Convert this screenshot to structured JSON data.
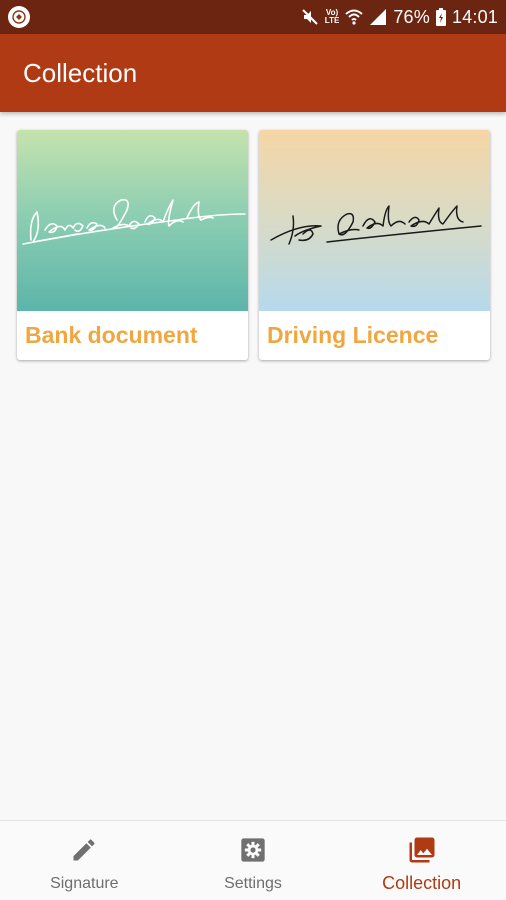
{
  "status_bar": {
    "battery_percent": "76%",
    "time": "14:01",
    "network_label_top": "Vo)",
    "network_label_bottom": "LTE",
    "icons": [
      "app-notification-icon",
      "mute-icon",
      "volte-icon",
      "wifi-icon",
      "signal-icon",
      "battery-icon"
    ]
  },
  "app_bar": {
    "title": "Collection",
    "color": "#b03a14"
  },
  "collection": {
    "items": [
      {
        "label": "Bank document",
        "signature_text": "LaraCroft"
      },
      {
        "label": "Driving Licence",
        "signature_text": "K. Atatürk"
      }
    ]
  },
  "bottom_nav": {
    "items": [
      {
        "label": "Signature",
        "icon": "pencil-icon",
        "active": false
      },
      {
        "label": "Settings",
        "icon": "gear-icon",
        "active": false
      },
      {
        "label": "Collection",
        "icon": "photo-library-icon",
        "active": true
      }
    ]
  },
  "colors": {
    "accent": "#b03a14",
    "status_bar": "#6b2510",
    "card_label": "#f0a740"
  }
}
